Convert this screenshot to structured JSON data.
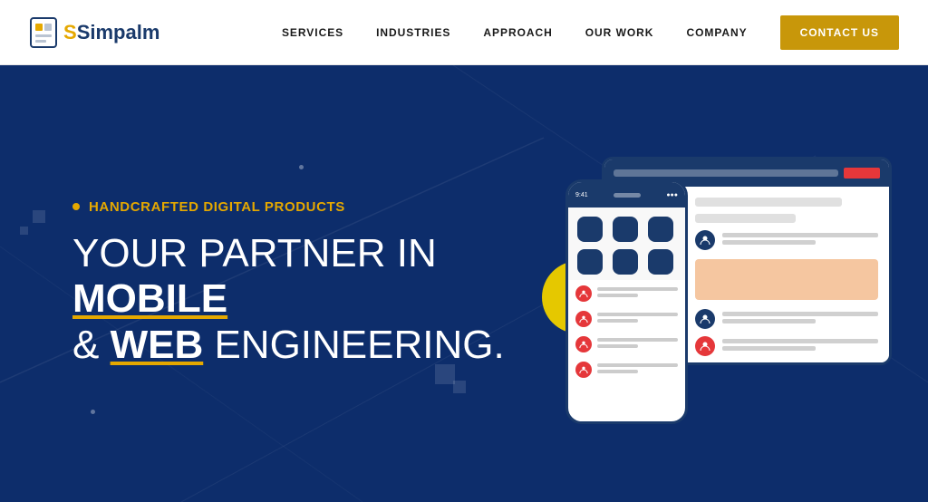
{
  "header": {
    "logo_text": "Simpalm",
    "nav_items": [
      {
        "id": "services",
        "label": "SERVICES"
      },
      {
        "id": "industries",
        "label": "INDUSTRIES"
      },
      {
        "id": "approach",
        "label": "APPROACH"
      },
      {
        "id": "our-work",
        "label": "OUR WORK"
      },
      {
        "id": "company",
        "label": "COMPANY"
      }
    ],
    "contact_btn": "CONTACT US"
  },
  "hero": {
    "subtitle": "HANDCRAFTED DIGITAL PRODUCTS",
    "title_part1": "YOUR PARTNER IN ",
    "title_bold1": "MOBILE",
    "title_part2": " & ",
    "title_bold2": "WEB",
    "title_part3": " ENGINEERING."
  },
  "colors": {
    "brand_blue": "#0d2d6b",
    "brand_gold": "#e5a800",
    "nav_dark": "#1a1a1a",
    "contact_bg": "#c8970a"
  }
}
